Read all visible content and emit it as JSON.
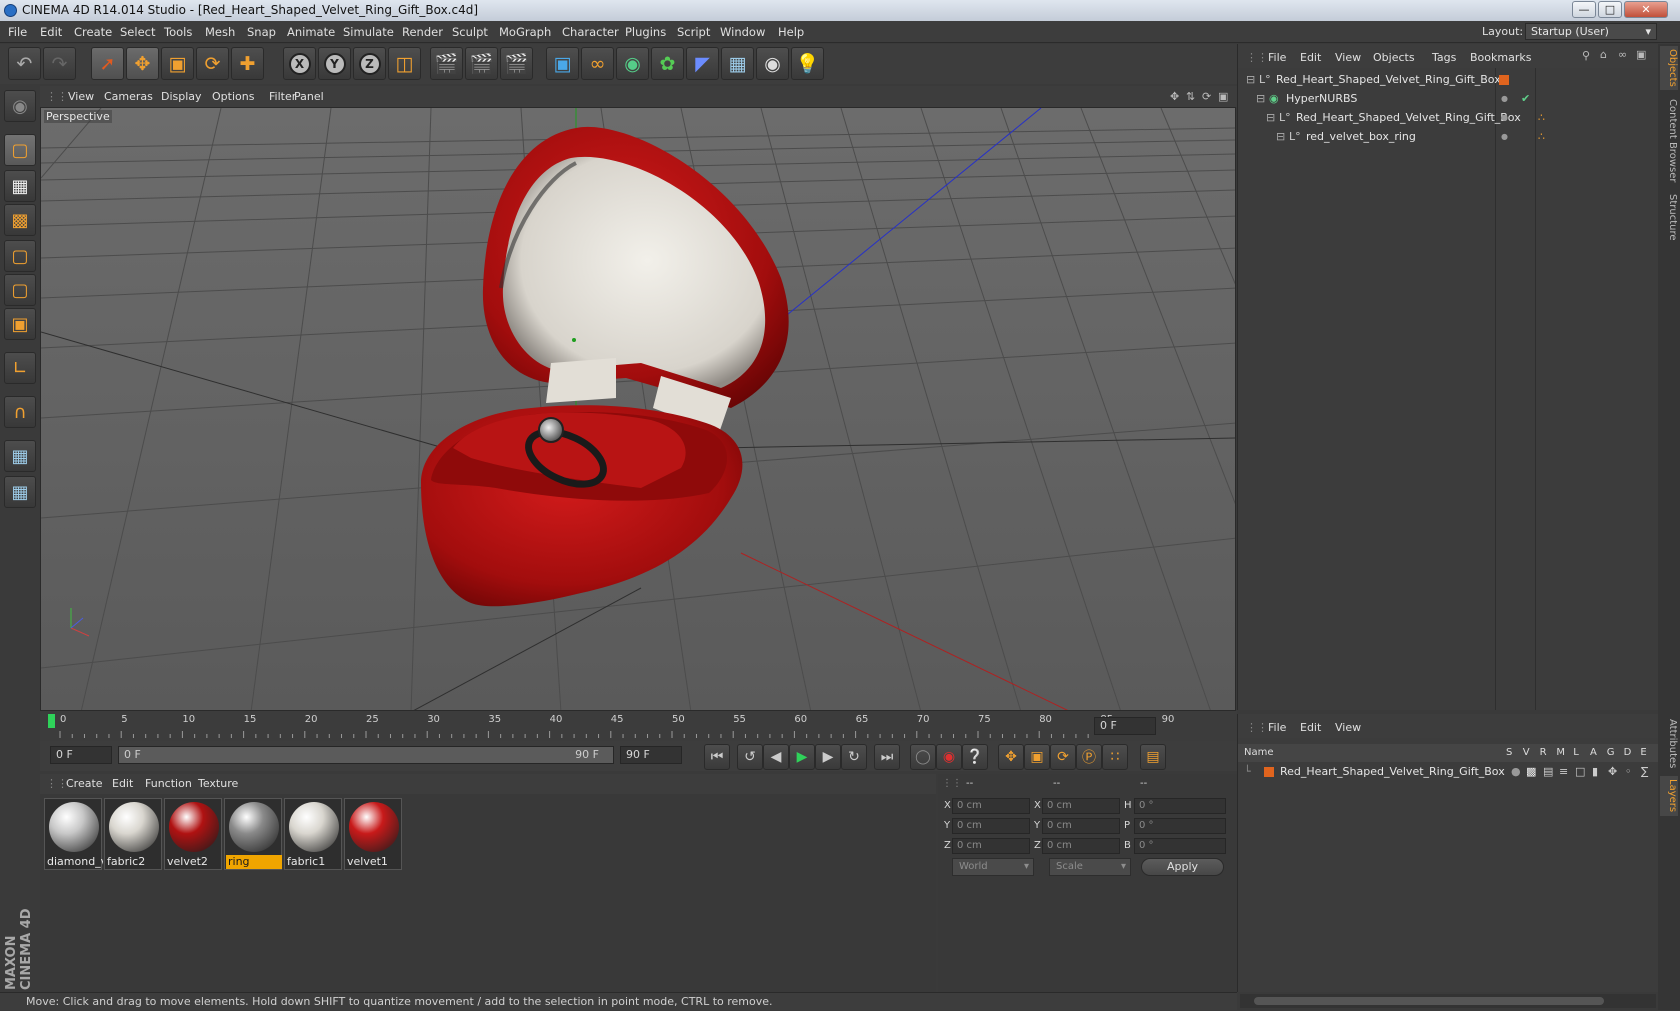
{
  "window": {
    "title": "CINEMA 4D R14.014 Studio - [Red_Heart_Shaped_Velvet_Ring_Gift_Box.c4d]"
  },
  "menubar": {
    "items": [
      "File",
      "Edit",
      "Create",
      "Select",
      "Tools",
      "Mesh",
      "Snap",
      "Animate",
      "Simulate",
      "Render",
      "Sculpt",
      "MoGraph",
      "Character",
      "Plugins",
      "Script",
      "Window",
      "Help"
    ],
    "layout_label": "Layout:",
    "layout_value": "Startup (User)"
  },
  "viewport": {
    "menu": [
      "View",
      "Cameras",
      "Display",
      "Options",
      "Filter",
      "Panel"
    ],
    "label": "Perspective"
  },
  "timeline": {
    "ticks": [
      "0",
      "5",
      "10",
      "15",
      "20",
      "25",
      "30",
      "35",
      "40",
      "45",
      "50",
      "55",
      "60",
      "65",
      "70",
      "75",
      "80",
      "85",
      "90"
    ],
    "frame_end_field": "0 F",
    "current_frame": "0 F",
    "range_start": "0 F",
    "range_end": "90 F",
    "max_frame": "90 F"
  },
  "materials": {
    "menu": [
      "Create",
      "Edit",
      "Function",
      "Texture"
    ],
    "items": [
      {
        "name": "diamond_v",
        "color": "#c8c8c8",
        "highlighted": false
      },
      {
        "name": "fabric2",
        "color": "#d9d6cf",
        "highlighted": false
      },
      {
        "name": "velvet2",
        "color": "#b01212",
        "highlighted": false
      },
      {
        "name": "ring",
        "color": "#8a8a8a",
        "highlighted": true
      },
      {
        "name": "fabric1",
        "color": "#d9d6cf",
        "highlighted": false
      },
      {
        "name": "velvet1",
        "color": "#c81a1a",
        "highlighted": false
      }
    ]
  },
  "coords": {
    "headers": [
      "--",
      "--",
      "--"
    ],
    "rows": [
      {
        "a": "X",
        "av": "0 cm",
        "b": "X",
        "bv": "0 cm",
        "c": "H",
        "cv": "0 °"
      },
      {
        "a": "Y",
        "av": "0 cm",
        "b": "Y",
        "bv": "0 cm",
        "c": "P",
        "cv": "0 °"
      },
      {
        "a": "Z",
        "av": "0 cm",
        "b": "Z",
        "bv": "0 cm",
        "c": "B",
        "cv": "0 °"
      }
    ],
    "space": "World",
    "mode": "Scale",
    "apply": "Apply"
  },
  "objects": {
    "menu": [
      "File",
      "Edit",
      "View",
      "Objects",
      "Tags",
      "Bookmarks"
    ],
    "tree": [
      {
        "name": "Red_Heart_Shaped_Velvet_Ring_Gift_Box",
        "depth": 0
      },
      {
        "name": "HyperNURBS",
        "depth": 1
      },
      {
        "name": "Red_Heart_Shaped_Velvet_Ring_Gift_Box",
        "depth": 2
      },
      {
        "name": "red_velvet_box_ring",
        "depth": 3
      }
    ]
  },
  "layers": {
    "menu": [
      "File",
      "Edit",
      "View"
    ],
    "header_name": "Name",
    "header_cols": [
      "S",
      "V",
      "R",
      "M",
      "L",
      "A",
      "G",
      "D",
      "E"
    ],
    "rows": [
      "Red_Heart_Shaped_Velvet_Ring_Gift_Box"
    ]
  },
  "right_tabs": [
    "Objects",
    "Content Browser",
    "Structure",
    "Attributes",
    "Layers"
  ],
  "brand": "MAXON CINEMA 4D",
  "status": "Move: Click and drag to move elements. Hold down SHIFT to quantize movement / add to the selection in point mode, CTRL to remove."
}
